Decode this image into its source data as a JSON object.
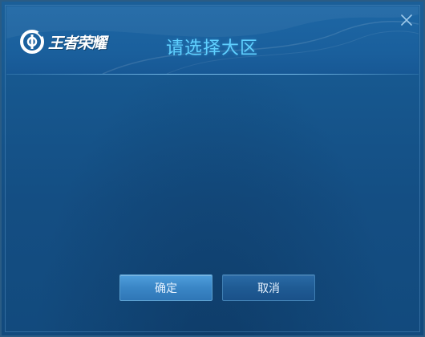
{
  "window": {
    "logo_text": "王者荣耀",
    "title": "请选择大区"
  },
  "buttons": {
    "confirm_label": "确定",
    "cancel_label": "取消"
  },
  "icons": {
    "logo": "game-logo-icon",
    "close": "close-icon"
  },
  "colors": {
    "title": "#5fd0ff",
    "background": "#15548a",
    "confirm_button": "#3a86c6",
    "cancel_button": "#1f5b94"
  }
}
